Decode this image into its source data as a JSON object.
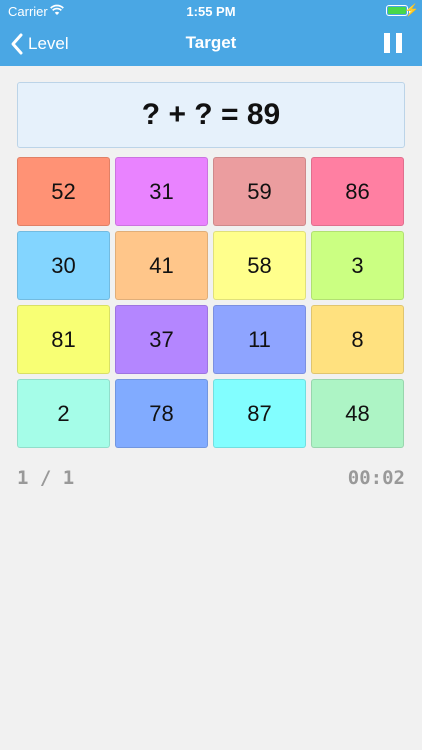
{
  "status_bar": {
    "carrier": "Carrier",
    "time": "1:55 PM",
    "battery_level": 1.0
  },
  "nav": {
    "back_label": "Level",
    "title": "Target"
  },
  "equation": "? + ? = 89",
  "tiles": [
    {
      "value": "52",
      "color": "#ff9275"
    },
    {
      "value": "31",
      "color": "#e983ff"
    },
    {
      "value": "59",
      "color": "#eb9d9f"
    },
    {
      "value": "86",
      "color": "#ff7fa2"
    },
    {
      "value": "30",
      "color": "#83d5ff"
    },
    {
      "value": "41",
      "color": "#ffc68a"
    },
    {
      "value": "58",
      "color": "#ffff8c"
    },
    {
      "value": "3",
      "color": "#cbff82"
    },
    {
      "value": "81",
      "color": "#f8ff74"
    },
    {
      "value": "37",
      "color": "#b486ff"
    },
    {
      "value": "11",
      "color": "#8ea4ff"
    },
    {
      "value": "8",
      "color": "#ffe17f"
    },
    {
      "value": "2",
      "color": "#a5fde8"
    },
    {
      "value": "78",
      "color": "#81abff"
    },
    {
      "value": "87",
      "color": "#82feff"
    },
    {
      "value": "48",
      "color": "#adf4c5"
    }
  ],
  "progress": "1 / 1",
  "timer": "00:02",
  "colors": {
    "nav_background": "#4aa7e4",
    "page_background": "#f1f1f1",
    "equation_background": "#e6f1fb"
  }
}
